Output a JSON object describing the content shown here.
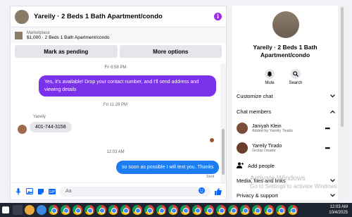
{
  "header": {
    "title": "Yareily · 2 Beds 1 Bath Apartment/condo"
  },
  "marketplace": {
    "label": "Marketplace",
    "listing": "$1,000 · 2 Beds 1 Bath Apartment/condo"
  },
  "buttons": {
    "mark_pending": "Mark as pending",
    "more_options": "More options"
  },
  "thread": {
    "ts1": "Fri 6:58 PM",
    "msg1": "Yes, it's available! Drop your contact number, and I'll send address and viewing details",
    "ts2": "Fri 11:28 PM",
    "sender": "Yareily",
    "msg2": "401-744-3158",
    "ts3": "12:03 AM",
    "msg3": "so soon as possible I will text you..Thanks",
    "sent": "Sent"
  },
  "composer": {
    "placeholder": "Aa"
  },
  "sidebar": {
    "title": "Yareily · 2 Beds 1 Bath Apartment/condo",
    "mute": "Mute",
    "search": "Search",
    "customize_chat": "Customize chat",
    "chat_members": "Chat members",
    "members": [
      {
        "name": "Janiyah Klein",
        "sub": "Added by Yareily Tirado"
      },
      {
        "name": "Yareily Tirado",
        "sub": "Group creator"
      }
    ],
    "add_people": "Add people",
    "media_files": "Media, files and links",
    "privacy": "Privacy & support"
  },
  "watermark": {
    "line1": "Activate Windows",
    "line2": "Go to Settings to activate Windows."
  },
  "taskbar": {
    "time": "12:03 AM",
    "date": "10/4/2025"
  },
  "colors": {
    "accent_purple": "#7b30ea",
    "bubble_blue": "#1c7cf4",
    "info_purple": "#9b2be3"
  }
}
